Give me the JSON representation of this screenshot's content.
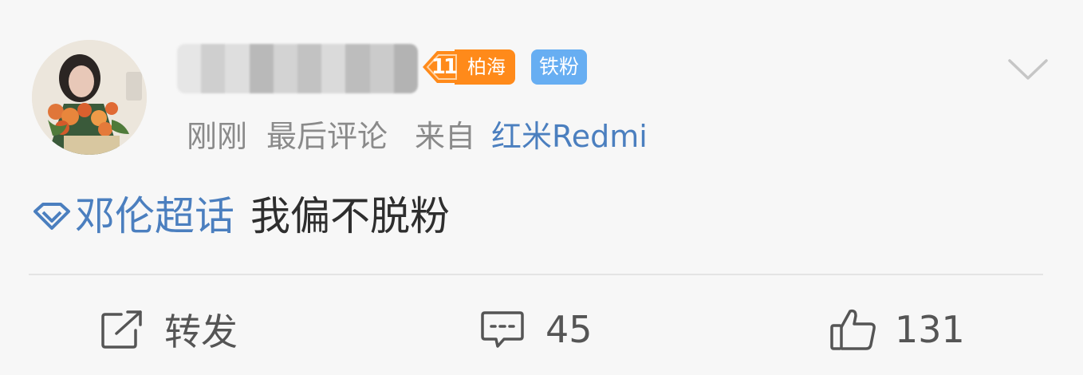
{
  "post": {
    "avatar_icon": "user-avatar",
    "username_label": "",
    "level_badge": {
      "level": "11",
      "label": "柏海",
      "color": "#ff8a1a"
    },
    "fan_badge": {
      "label": "铁粉",
      "color": "#67aef2"
    },
    "meta": {
      "time": "刚刚",
      "status": "最后评论",
      "source_prefix": "来自",
      "source": "红米Redmi"
    },
    "content": {
      "topic_icon": "super-topic-diamond-icon",
      "topic": "邓伦超话",
      "text": "我偏不脱粉"
    }
  },
  "actions": {
    "repost": {
      "icon": "share-icon",
      "label": "转发"
    },
    "comment": {
      "icon": "comment-icon",
      "count": "45"
    },
    "like": {
      "icon": "thumbs-up-icon",
      "count": "131"
    }
  },
  "colors": {
    "link": "#4b7fbf",
    "meta_text": "#8a8a8a",
    "body_text": "#2e2e2e",
    "background": "#f7f7f7"
  }
}
